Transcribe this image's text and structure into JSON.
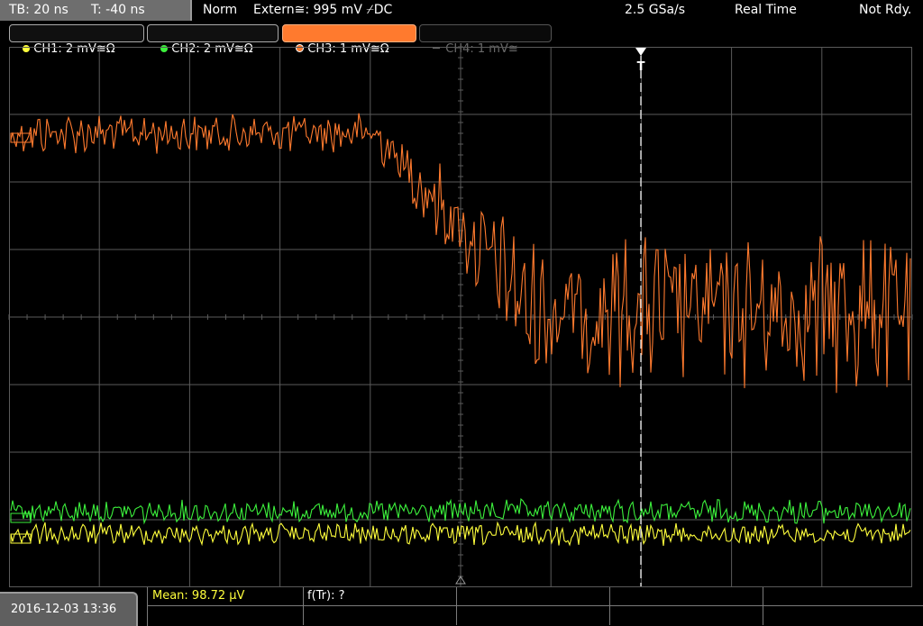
{
  "topbar": {
    "timebase": "TB: 20 ns",
    "trigger_time": "T: -40 ns",
    "mode": "Norm",
    "trigger_source": "Extern≅: 995 mV ⌿DC",
    "sample_rate": "2.5 GSa/s",
    "acq_mode": "Real Time",
    "status": "Not Rdy."
  },
  "channels": [
    {
      "label": "CH1: 2 mV≅Ω",
      "color": "#ffff3c",
      "active": true
    },
    {
      "label": "CH2: 2 mV≅Ω",
      "color": "#3cf03c",
      "active": true
    },
    {
      "label": "CH3: 1 mV≅Ω",
      "color": "#ff7a2e",
      "active": true,
      "selected": true
    },
    {
      "label": "CH4: 1 mV≅",
      "color": "#7a7a7a",
      "active": false
    }
  ],
  "markers": {
    "trigger": "T"
  },
  "measurements": {
    "mean": "Mean: 98.72 µV",
    "ftr": "f(Tr): ?"
  },
  "datetime": "2016-12-03 13:36",
  "colors": {
    "ch1": "#ffff3c",
    "ch2": "#3cf03c",
    "ch3": "#ff7a2e",
    "grid": "#5a5a5a"
  }
}
